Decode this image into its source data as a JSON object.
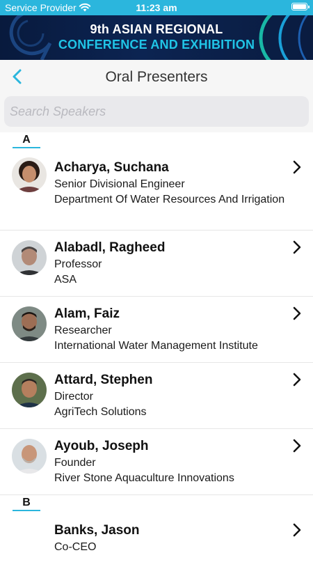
{
  "status_bar": {
    "carrier": "Service Provider",
    "time": "11:23 am"
  },
  "banner": {
    "line1": "9th ASIAN REGIONAL",
    "line2": "CONFERENCE AND EXHIBITION",
    "accent_color": "#20c4e6"
  },
  "nav": {
    "back_icon": "chevron-left-icon",
    "title": "Oral Presenters"
  },
  "search": {
    "placeholder": "Search Speakers",
    "value": ""
  },
  "sections": [
    {
      "letter": "A",
      "speakers": [
        {
          "name": "Acharya, Suchana",
          "role": "Senior Divisional Engineer",
          "organization": "Department Of Water Resources And Irrigation"
        },
        {
          "name": "Alabadl, Ragheed",
          "role": "Professor",
          "organization": "ASA"
        },
        {
          "name": "Alam, Faiz",
          "role": "Researcher",
          "organization": "International Water Management Institute"
        },
        {
          "name": "Attard, Stephen",
          "role": "Director",
          "organization": "AgriTech Solutions"
        },
        {
          "name": "Ayoub, Joseph",
          "role": "Founder",
          "organization": "River Stone Aquaculture Innovations"
        }
      ]
    },
    {
      "letter": "B",
      "speakers": [
        {
          "name": "Banks, Jason",
          "role": "Co-CEO",
          "organization": ""
        }
      ]
    }
  ],
  "colors": {
    "status_bar": "#2bb6dd",
    "accent": "#2bb6dd",
    "banner_bg": "#0c2452"
  }
}
